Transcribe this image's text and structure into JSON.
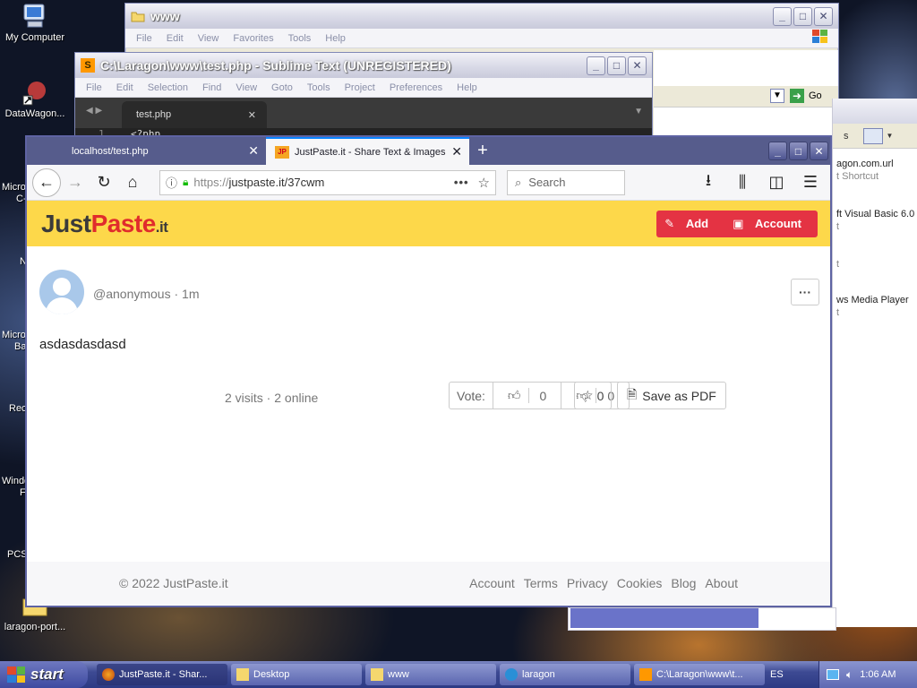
{
  "desktop": {
    "icons": [
      {
        "label": "My Computer"
      },
      {
        "label": "DataWagon..."
      },
      {
        "label": "laragon-port..."
      }
    ],
    "clipped_labels": [
      "Micro",
      "C-",
      "N",
      "Micro",
      "Ba",
      "Rec",
      "Windo",
      "F",
      "PCS"
    ]
  },
  "explorer": {
    "title": "www",
    "menu": [
      "File",
      "Edit",
      "View",
      "Favorites",
      "Tools",
      "Help"
    ],
    "go_label": "Go",
    "files": [
      "agon.com.url",
      "t Shortcut",
      "ft Visual Basic 6.0",
      "t",
      "t",
      "ws Media Player",
      "t"
    ]
  },
  "sublime": {
    "title": "C:\\Laragon\\www\\test.php - Sublime Text (UNREGISTERED)",
    "menu": [
      "File",
      "Edit",
      "Selection",
      "Find",
      "View",
      "Goto",
      "Tools",
      "Project",
      "Preferences",
      "Help"
    ],
    "tab": "test.php",
    "line_number": "1",
    "code": "<?php"
  },
  "firefox": {
    "tabs": [
      {
        "label": "localhost/test.php"
      },
      {
        "label": "JustPaste.it - Share Text & Images"
      }
    ],
    "url_prefix": "https://",
    "url_rest": "justpaste.it/37cwm",
    "search_placeholder": "Search"
  },
  "page": {
    "logo_just": "Just",
    "logo_paste": "Paste",
    "logo_it": ".it",
    "add_label": "Add",
    "account_label": "Account",
    "author": "@anonymous",
    "time": "1m",
    "content": "asdasdasdasd",
    "stats": "2 visits · 2 online",
    "vote_label": "Vote:",
    "up_count": "0",
    "down_count": "0",
    "fav_count": "0",
    "pdf_label": "Save as PDF",
    "copyright": "© 2022 JustPaste.it",
    "footer_links": [
      "Account",
      "Terms",
      "Privacy",
      "Cookies",
      "Blog",
      "About"
    ]
  },
  "taskbar": {
    "start": "start",
    "tasks": [
      {
        "label": "JustPaste.it - Shar..."
      },
      {
        "label": "Desktop"
      },
      {
        "label": "www"
      },
      {
        "label": "laragon"
      },
      {
        "label": "C:\\Laragon\\www\\t..."
      }
    ],
    "lang": "ES",
    "clock": "1:06 AM"
  },
  "colors": {
    "jp_yellow": "#fdd84a",
    "jp_red": "#e43343",
    "ff_tabbar": "#565c8c",
    "taskbar": "#3d4a93"
  }
}
